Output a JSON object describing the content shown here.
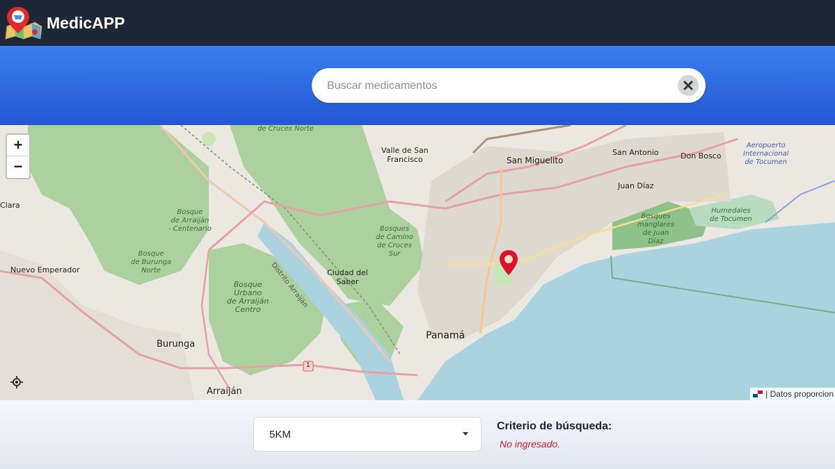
{
  "app": {
    "name": "MedicAPP",
    "logo_icon": "map-pin-logo-icon"
  },
  "search": {
    "placeholder": "Buscar medicamentos",
    "value": "",
    "clear_icon": "close-icon"
  },
  "map": {
    "zoom_in_label": "+",
    "zoom_out_label": "−",
    "attribution": "| Datos proporcion",
    "labels": {
      "cruces_norte": "de Cruces\nNorte",
      "valle_san_francisco": "Valle de San\nFrancisco",
      "san_miguelito": "San Miguelito",
      "san_antonio": "San Antonio",
      "don_bosco": "Don Bosco",
      "aeropuerto": "Aeropuerto\nInternacional\nde Tocumen",
      "juan_diaz": "Juan Díaz",
      "bosque_arraijan_centenario": "Bosque\nde Arraiján\n- Centenario",
      "bosques_camino_cruces_sur": "Bosques\nde Camino\nde Cruces\nSur",
      "humedales": "Humedales\nde Tocumen",
      "bosques_manglares": "Bosques\nmanglares\nde Juan\nDíaz",
      "clara": "Clara",
      "bosque_burunga_norte": "Bosque\nde Burunga\nNorte",
      "nuevo_emperador": "Nuevo Emperador",
      "ciudad_del_saber": "Ciudad del\nSaber",
      "bosque_urbano_arraijan": "Bosque\nUrbano\nde Arraiján\nCentro",
      "panama": "Panamá",
      "burunga": "Burunga",
      "arraijan": "Arraiján",
      "distrito_arraijan": "Distrito Arraiján",
      "route_1": "1"
    }
  },
  "filters": {
    "radius_selected": "5KM",
    "criteria_title": "Criterio de búsqueda:",
    "criteria_value": "No ingresado."
  },
  "colors": {
    "navbar": "#1e2738",
    "band_top": "#3a7ef0",
    "band_bottom": "#2557d4",
    "marker": "#e0102c",
    "water": "#aad3df",
    "park": "#8fc28a"
  }
}
